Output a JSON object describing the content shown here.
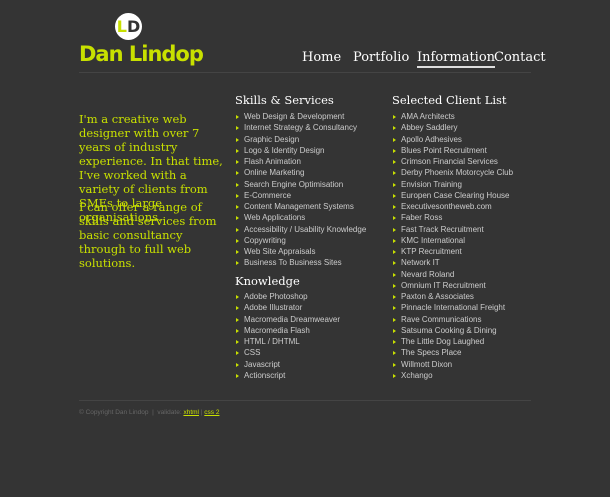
{
  "logo": {
    "mark": "LD",
    "name": "Dan Lindop"
  },
  "nav": [
    "Home",
    "Portfolio",
    "Information",
    "Contact"
  ],
  "intro": [
    "I'm a creative web designer with over 7 years of industry experience. In that time, I've worked with a variety of clients from SMEs to large organisations.",
    "I can offer a range of skills and services from basic consultancy through to full web solutions."
  ],
  "skills": {
    "title": "Skills & Services",
    "items": [
      "Web Design & Development",
      "Internet Strategy & Consultancy",
      "Graphic Design",
      "Logo & Identity Design",
      "Flash Animation",
      "Online Marketing",
      "Search Engine Optimisation",
      "E-Commerce",
      "Content Management Systems",
      "Web Applications",
      "Accessibility / Usability Knowledge",
      "Copywriting",
      "Web Site Appraisals",
      "Business To Business Sites"
    ]
  },
  "knowledge": {
    "title": "Knowledge",
    "items": [
      "Adobe Photoshop",
      "Adobe Illustrator",
      "Macromedia Dreamweaver",
      "Macromedia Flash",
      "HTML / DHTML",
      "CSS",
      "Javascript",
      "Actionscript"
    ]
  },
  "clients": {
    "title": "Selected Client List",
    "items": [
      "AMA Architects",
      "Abbey Saddlery",
      "Apollo Adhesives",
      "Blues Point Recruitment",
      "Crimson Financial Services",
      "Derby Phoenix Motorcycle Club",
      "Envision Training",
      "Europen Case Clearing House",
      "Executivesontheweb.com",
      "Faber Ross",
      "Fast Track Recruitment",
      "KMC International",
      "KTP Recruitment",
      "Network IT",
      "Nevard Roland",
      "Omnium IT Recruitment",
      "Paxton & Associates",
      "Pinnacle International Freight",
      "Rave Communications",
      "Satsuma Cooking & Dining",
      "The Little Dog Laughed",
      "The Specs Place",
      "Willmott Dixon",
      "Xchango"
    ]
  },
  "footer": {
    "copyright": "© Copyright Dan Lindop",
    "sep": "|",
    "validate": "validate:",
    "xhtml": "xhtml",
    "css": "css 2"
  },
  "colors": {
    "accent": "#c8e000",
    "background": "#343434"
  }
}
